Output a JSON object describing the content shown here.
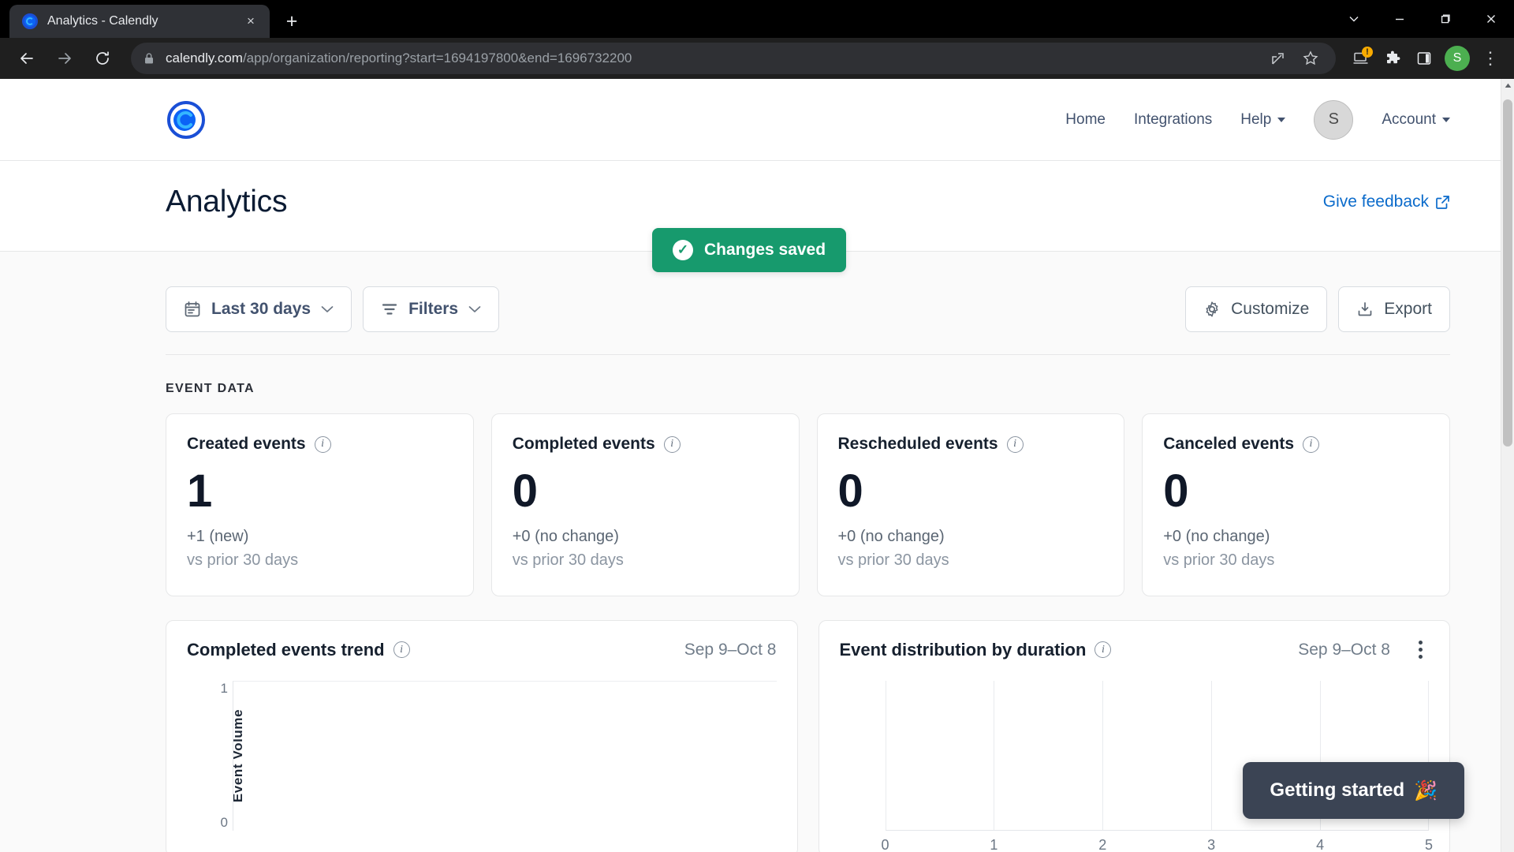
{
  "browser": {
    "tab": {
      "title": "Analytics - Calendly",
      "favicon": "calendly-favicon",
      "close_label": "×"
    },
    "new_tab_label": "+",
    "window_controls": [
      "tab-search-chevron",
      "minimize",
      "maximize",
      "close"
    ],
    "back_label": "back",
    "forward_label": "forward",
    "reload_label": "reload",
    "url_host": "calendly.com",
    "url_path": "/app/organization/reporting?start=1694197800&end=1696732200",
    "lock_icon": "lock-icon",
    "toolbar_icons": [
      "share-icon",
      "bookmark-star-icon",
      "update-available-icon",
      "extensions-icon",
      "side-panel-icon"
    ],
    "extension_badge": "!",
    "profile_initial": "S",
    "menu_label": "⋮"
  },
  "header": {
    "logo": "calendly-logo",
    "nav": [
      {
        "label": "Home",
        "dropdown": false
      },
      {
        "label": "Integrations",
        "dropdown": false
      },
      {
        "label": "Help",
        "dropdown": true
      }
    ],
    "avatar_initial": "S",
    "account": {
      "label": "Account",
      "dropdown": true
    }
  },
  "toast": {
    "text": "Changes saved",
    "icon": "check-circle-icon",
    "color": "#179a6d"
  },
  "title_bar": {
    "title": "Analytics",
    "feedback_label": "Give feedback",
    "feedback_icon": "external-link-icon"
  },
  "filters": {
    "date_range": {
      "label": "Last 30 days",
      "icon": "calendar-icon",
      "chevron": "chevron-down-icon"
    },
    "filters": {
      "label": "Filters",
      "icon": "filter-icon",
      "chevron": "chevron-down-icon"
    },
    "customize": {
      "label": "Customize",
      "icon": "gear-icon"
    },
    "export": {
      "label": "Export",
      "icon": "download-icon"
    }
  },
  "event_data": {
    "section_label": "EVENT DATA",
    "cards": [
      {
        "title": "Created events",
        "value": "1",
        "delta": "+1 (new)",
        "sub": "vs prior 30 days",
        "info": "info-icon"
      },
      {
        "title": "Completed events",
        "value": "0",
        "delta": "+0 (no change)",
        "sub": "vs prior 30 days",
        "info": "info-icon"
      },
      {
        "title": "Rescheduled events",
        "value": "0",
        "delta": "+0 (no change)",
        "sub": "vs prior 30 days",
        "info": "info-icon"
      },
      {
        "title": "Canceled events",
        "value": "0",
        "delta": "+0 (no change)",
        "sub": "vs prior 30 days",
        "info": "info-icon"
      }
    ]
  },
  "chart_data": [
    {
      "type": "line",
      "title": "Completed events trend",
      "range": "Sep 9–Oct 8",
      "xlabel": "",
      "ylabel": "Event Volume",
      "x": [],
      "values": [],
      "yticks": [
        "1",
        "0"
      ],
      "ylim": [
        0,
        1
      ],
      "grid": true,
      "legend": "none"
    },
    {
      "type": "bar",
      "title": "Event distribution by duration",
      "range": "Sep 9–Oct 8",
      "xlabel": "",
      "ylabel": "",
      "categories": [],
      "values": [],
      "xticks": [
        "0",
        "1",
        "2",
        "3",
        "4",
        "5"
      ],
      "xlim": [
        0,
        5
      ],
      "grid": true,
      "legend": "none",
      "menu": "kebab-menu-icon"
    }
  ],
  "getting_started": {
    "label": "Getting started",
    "icon": "🎉"
  },
  "scrollbar": {
    "up_arrow": "scroll-up-arrow"
  }
}
